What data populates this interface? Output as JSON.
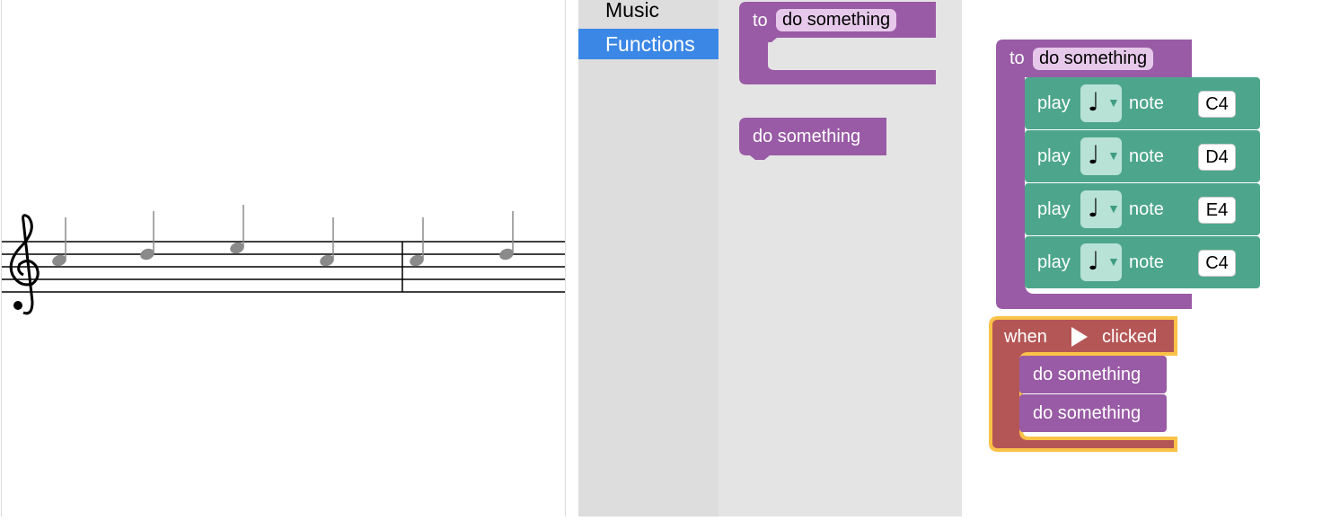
{
  "toolbox": {
    "categories": [
      {
        "label": "Music",
        "selected": false
      },
      {
        "label": "Functions",
        "selected": true
      }
    ]
  },
  "flyout": {
    "define_block": {
      "to_label": "to",
      "name": "do something"
    },
    "call_block": {
      "label": "do something"
    }
  },
  "workspace": {
    "procedure": {
      "to_label": "to",
      "name": "do something",
      "play_notes": [
        {
          "play_label": "play",
          "note_label": "note",
          "duration_icon": "quarter-note-icon",
          "pitch": "C4"
        },
        {
          "play_label": "play",
          "note_label": "note",
          "duration_icon": "quarter-note-icon",
          "pitch": "D4"
        },
        {
          "play_label": "play",
          "note_label": "note",
          "duration_icon": "quarter-note-icon",
          "pitch": "E4"
        },
        {
          "play_label": "play",
          "note_label": "note",
          "duration_icon": "quarter-note-icon",
          "pitch": "C4"
        }
      ]
    },
    "event": {
      "when_label": "when",
      "icon": "play-triangle-icon",
      "clicked_label": "clicked",
      "calls": [
        "do something",
        "do something"
      ]
    }
  },
  "staff": {
    "clef": "treble-clef-icon",
    "note_glyph": "♩",
    "notes": [
      {
        "pitch": "C4"
      },
      {
        "pitch": "D4"
      },
      {
        "pitch": "E4"
      },
      {
        "pitch": "C4"
      },
      {
        "pitch": "C4"
      },
      {
        "pitch": "D4"
      }
    ]
  },
  "colors": {
    "procedure_block": "#995ba5",
    "music_block": "#4da68b",
    "event_block": "#b55656",
    "selection_outline": "#fbc248",
    "toolbox_selected": "#3b87e6"
  }
}
